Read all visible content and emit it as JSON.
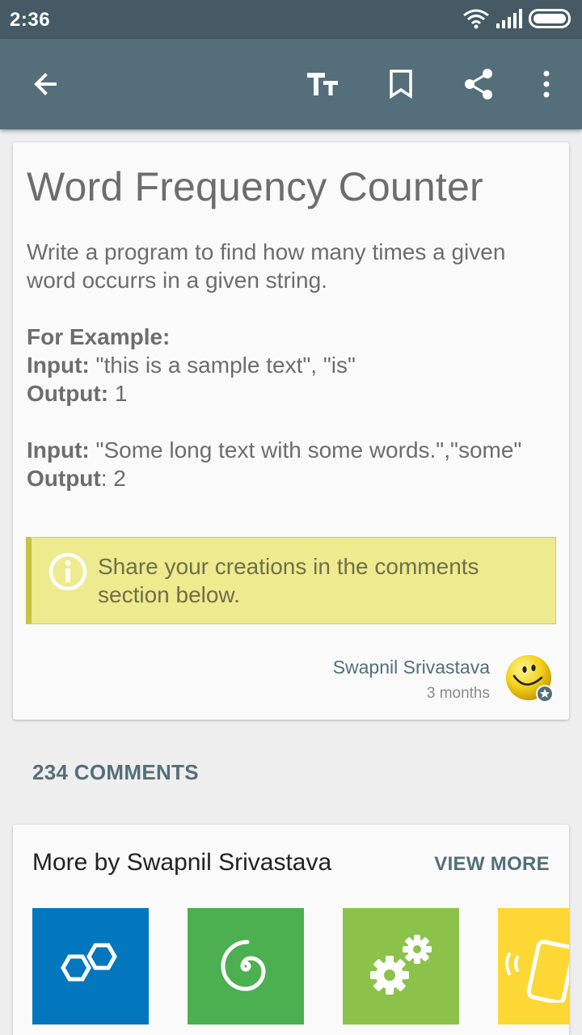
{
  "status": {
    "time": "2:36"
  },
  "toolbar": {
    "back_icon": "arrow-back-icon",
    "text_size_icon": "text-size-icon",
    "bookmark_icon": "bookmark-icon",
    "share_icon": "share-icon",
    "more_icon": "more-vert-icon"
  },
  "post": {
    "title": "Word Frequency Counter",
    "description": "Write a program to find how many times a given word occurrs in a given string.",
    "example_heading": "For Example:",
    "ex1": {
      "input_label": "Input:",
      "input_value": " \"this is a sample text\", \"is\"",
      "output_label": "Output:",
      "output_value": " 1"
    },
    "ex2": {
      "input_label": "Input:",
      "input_value": " \"Some long text with some words.\",\"some\"",
      "output_label": "Output",
      "output_value": ": 2"
    },
    "tip": "Share your creations in the comments section below.",
    "author": "Swapnil Srivastava",
    "posted": "3 months"
  },
  "comments": {
    "label": "234 COMMENTS"
  },
  "more": {
    "title": "More by Swapnil Srivastava",
    "view_more": "VIEW MORE",
    "colors": [
      "#0277bd",
      "#4caf50",
      "#8bc34a",
      "#fdd835"
    ]
  }
}
